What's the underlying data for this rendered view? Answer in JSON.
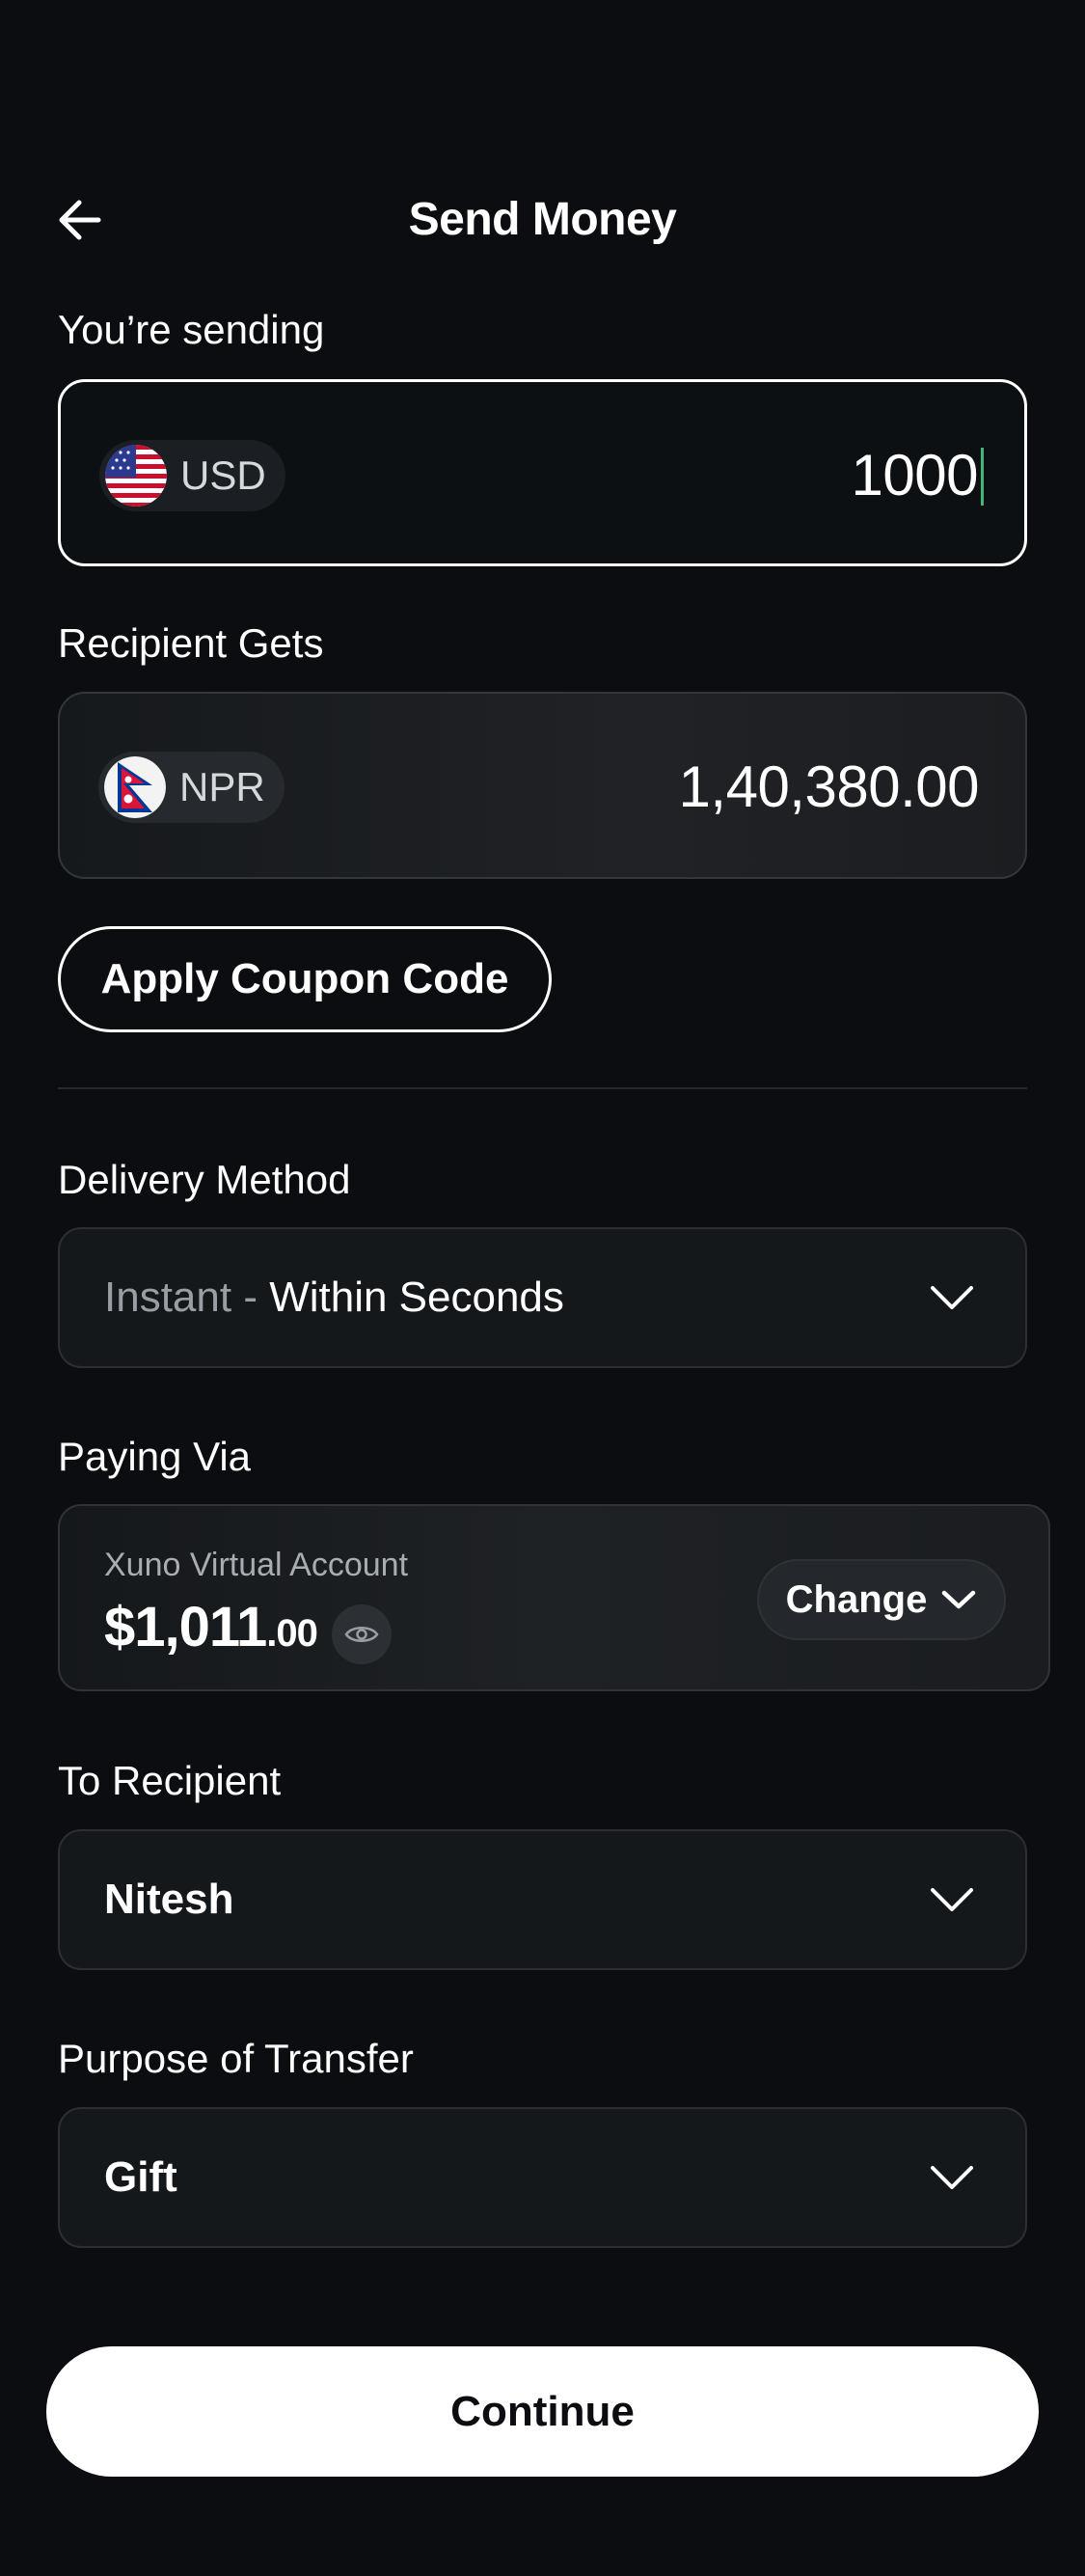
{
  "header": {
    "title": "Send Money",
    "back_icon": "arrow-left-icon"
  },
  "sending": {
    "label": "You’re sending",
    "currency": "USD",
    "flag": "us-flag-icon",
    "amount": "1000"
  },
  "recipient_gets": {
    "label": "Recipient Gets",
    "currency": "NPR",
    "flag": "np-flag-icon",
    "amount": "1,40,380.00"
  },
  "coupon": {
    "label": "Apply Coupon Code"
  },
  "delivery": {
    "label": "Delivery Method",
    "speed": "Instant",
    "separator": " - ",
    "detail": "Within Seconds"
  },
  "paying": {
    "label": "Paying Via",
    "account_name": "Xuno Virtual Account",
    "balance_main": "$1,011",
    "balance_decimal": ".00",
    "change_label": "Change"
  },
  "recipient": {
    "label": "To Recipient",
    "value": "Nitesh"
  },
  "purpose": {
    "label": "Purpose of Transfer",
    "value": "Gift"
  },
  "continue_label": "Continue",
  "colors": {
    "background": "#0b0d10",
    "accent_cursor": "#3fb87a",
    "button": "#ffffff"
  }
}
